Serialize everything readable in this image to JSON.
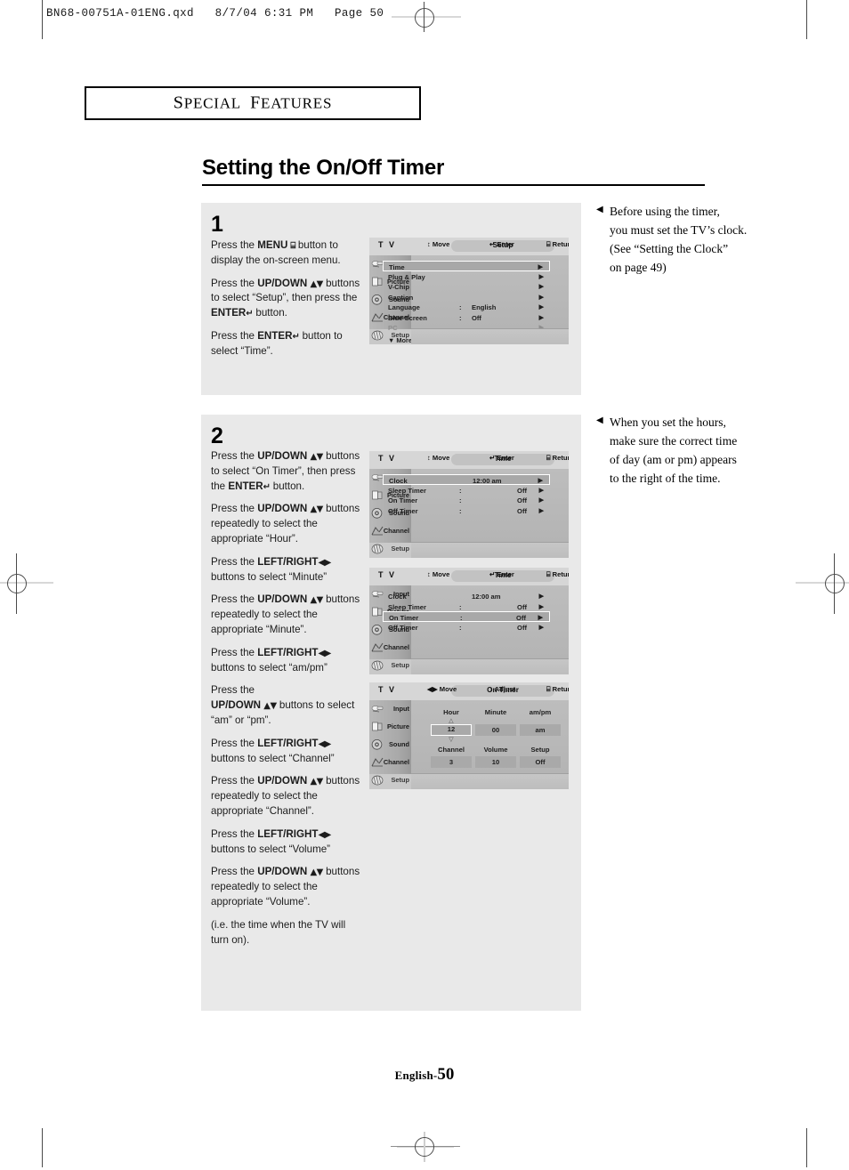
{
  "file_header": "BN68-00751A-01ENG.qxd   8/7/04 6:31 PM   Page 50",
  "section_label": "Special Features",
  "page_title": "Setting the On/Off Timer",
  "footer": {
    "language": "English-",
    "page_number": "50"
  },
  "steps": [
    {
      "number": "1",
      "paragraphs": [
        {
          "parts": [
            {
              "t": "Press the ",
              "b": false
            },
            {
              "t": "MENU",
              "b": true
            },
            {
              "t": " ⌸ ",
              "b": true,
              "glyph": true
            },
            {
              "t": "button to display the on-screen menu.",
              "b": false
            }
          ]
        },
        {
          "parts": [
            {
              "t": "Press the ",
              "b": false
            },
            {
              "t": "UP/DOWN ",
              "b": true
            },
            {
              "t": "▲▼",
              "b": true,
              "glyph": true
            },
            {
              "t": " buttons  to select “Setup”, then press the ",
              "b": false
            },
            {
              "t": "ENTER",
              "b": true
            },
            {
              "t": "↵",
              "b": true,
              "glyph": true
            },
            {
              "t": " button.",
              "b": false
            }
          ]
        },
        {
          "parts": [
            {
              "t": "Press the ",
              "b": false
            },
            {
              "t": "ENTER",
              "b": true
            },
            {
              "t": "↵",
              "b": true,
              "glyph": true
            },
            {
              "t": " button to select “Time”.",
              "b": false
            }
          ]
        }
      ]
    },
    {
      "number": "2",
      "paragraphs": [
        {
          "parts": [
            {
              "t": "Press the ",
              "b": false
            },
            {
              "t": "UP/DOWN ",
              "b": true
            },
            {
              "t": "▲▼",
              "b": true,
              "glyph": true
            },
            {
              "t": " buttons to select “On Timer”, then press the ",
              "b": false
            },
            {
              "t": "ENTER",
              "b": true
            },
            {
              "t": "↵",
              "b": true,
              "glyph": true
            },
            {
              "t": " button.",
              "b": false
            }
          ]
        },
        {
          "parts": [
            {
              "t": "Press the ",
              "b": false
            },
            {
              "t": "UP/DOWN ",
              "b": true
            },
            {
              "t": "▲▼",
              "b": true,
              "glyph": true
            },
            {
              "t": " buttons repeatedly to select the appropriate “Hour”.",
              "b": false
            }
          ]
        },
        {
          "parts": [
            {
              "t": "Press the ",
              "b": false
            },
            {
              "t": "LEFT/RIGHT",
              "b": true
            },
            {
              "t": "◀▶",
              "b": true,
              "glyph": true
            },
            {
              "t": " buttons to select “Minute”",
              "b": false
            }
          ]
        },
        {
          "parts": [
            {
              "t": "Press the ",
              "b": false
            },
            {
              "t": "UP/DOWN ",
              "b": true
            },
            {
              "t": "▲▼",
              "b": true,
              "glyph": true
            },
            {
              "t": " buttons repeatedly to select the appropriate “Minute”.",
              "b": false
            }
          ]
        },
        {
          "parts": [
            {
              "t": "Press the ",
              "b": false
            },
            {
              "t": "LEFT/RIGHT",
              "b": true
            },
            {
              "t": "◀▶",
              "b": true,
              "glyph": true
            },
            {
              "t": " buttons to select “am/pm”",
              "b": false
            }
          ]
        },
        {
          "parts": [
            {
              "t": "Press the ",
              "b": false
            },
            {
              "t": "\n",
              "b": false
            },
            {
              "t": "UP/DOWN ",
              "b": true
            },
            {
              "t": "▲▼",
              "b": true,
              "glyph": true
            },
            {
              "t": "  buttons to select “am” or “pm”.",
              "b": false
            }
          ]
        },
        {
          "parts": [
            {
              "t": "Press the ",
              "b": false
            },
            {
              "t": "LEFT/RIGHT",
              "b": true
            },
            {
              "t": "◀▶",
              "b": true,
              "glyph": true
            },
            {
              "t": " buttons to select “Channel”",
              "b": false
            }
          ]
        },
        {
          "parts": [
            {
              "t": "Press the ",
              "b": false
            },
            {
              "t": "UP/DOWN ",
              "b": true
            },
            {
              "t": "▲▼",
              "b": true,
              "glyph": true
            },
            {
              "t": " buttons repeatedly to select the appropriate “Channel”.",
              "b": false
            }
          ]
        },
        {
          "parts": [
            {
              "t": "Press the ",
              "b": false
            },
            {
              "t": "LEFT/RIGHT",
              "b": true
            },
            {
              "t": "◀▶",
              "b": true,
              "glyph": true
            },
            {
              "t": " buttons to select “Volume”",
              "b": false
            }
          ]
        },
        {
          "parts": [
            {
              "t": "Press the ",
              "b": false
            },
            {
              "t": "UP/DOWN ",
              "b": true
            },
            {
              "t": "▲▼",
              "b": true,
              "glyph": true
            },
            {
              "t": " buttons repeatedly to select the appropriate “Volume”.",
              "b": false
            }
          ]
        },
        {
          "parts": [
            {
              "t": "(i.e. the time when the TV will turn on).",
              "b": false
            }
          ]
        }
      ]
    }
  ],
  "osd_common": {
    "tv_label": "T V",
    "sidebar": [
      "Input",
      "Picture",
      "Sound",
      "Channel",
      "Setup"
    ],
    "hints_move": "Move",
    "hints_enter": "Enter",
    "hints_adjust": "Adjust",
    "hints_return": "Return"
  },
  "osd_screens": [
    {
      "id": "setup",
      "title": "Setup",
      "active_sidebar": "Setup",
      "rows": [
        {
          "name": "Time",
          "colon": "",
          "value": "",
          "arrow": "▶",
          "highlight": true,
          "dim": false
        },
        {
          "name": "Plug & Play",
          "colon": "",
          "value": "",
          "arrow": "▶",
          "highlight": false,
          "dim": false
        },
        {
          "name": "V-Chip",
          "colon": "",
          "value": "",
          "arrow": "▶",
          "highlight": false,
          "dim": false
        },
        {
          "name": "Caption",
          "colon": "",
          "value": "",
          "arrow": "▶",
          "highlight": false,
          "dim": false
        },
        {
          "name": "Language",
          "colon": ":",
          "value": "English",
          "arrow": "▶",
          "highlight": false,
          "dim": false
        },
        {
          "name": "Blue Screen",
          "colon": ":",
          "value": "Off",
          "arrow": "▶",
          "highlight": false,
          "dim": false
        },
        {
          "name": "PC",
          "colon": "",
          "value": "",
          "arrow": "▶",
          "highlight": false,
          "dim": true
        }
      ],
      "more": "▼ More",
      "hints": [
        "↕ Move",
        "↵ Enter",
        "⌸ Return"
      ]
    },
    {
      "id": "time-clock",
      "title": "Time",
      "active_sidebar": "Setup",
      "rows": [
        {
          "name": "Clock",
          "colon": "",
          "value": "12:00 am",
          "value_pos": "mid",
          "arrow": "▶",
          "highlight": true,
          "dim": false
        },
        {
          "name": "Sleep Timer",
          "colon": ":",
          "value": "Off",
          "value_pos": "right",
          "arrow": "▶",
          "highlight": false,
          "dim": false
        },
        {
          "name": "On Timer",
          "colon": ":",
          "value": "Off",
          "value_pos": "right",
          "arrow": "▶",
          "highlight": false,
          "dim": false
        },
        {
          "name": "Off Timer",
          "colon": ":",
          "value": "Off",
          "value_pos": "right",
          "arrow": "▶",
          "highlight": false,
          "dim": false
        }
      ],
      "hints": [
        "↕ Move",
        "↵ Enter",
        "⌸ Return"
      ]
    },
    {
      "id": "time-ontimer",
      "title": "Time",
      "active_sidebar": "Setup",
      "rows": [
        {
          "name": "Clock",
          "colon": "",
          "value": "12:00 am",
          "value_pos": "mid",
          "arrow": "▶",
          "highlight": false,
          "dim": false
        },
        {
          "name": "Sleep Timer",
          "colon": ":",
          "value": "Off",
          "value_pos": "right",
          "arrow": "▶",
          "highlight": false,
          "dim": false
        },
        {
          "name": "On Timer",
          "colon": ":",
          "value": "Off",
          "value_pos": "right",
          "arrow": "▶",
          "highlight": true,
          "dim": false
        },
        {
          "name": "Off Timer",
          "colon": ":",
          "value": "Off",
          "value_pos": "right",
          "arrow": "▶",
          "highlight": false,
          "dim": false
        }
      ],
      "hints": [
        "↕ Move",
        "↵ Enter",
        "⌸ Return"
      ]
    },
    {
      "id": "on-timer",
      "title": "On Timer",
      "active_sidebar": "Setup",
      "grid": {
        "row1_headers": [
          "Hour",
          "Minute",
          "am/pm"
        ],
        "row1_values": [
          "12",
          "00",
          "am"
        ],
        "row1_selected_index": 0,
        "row2_headers": [
          "Channel",
          "Volume",
          "Setup"
        ],
        "row2_values": [
          "3",
          "10",
          "Off"
        ]
      },
      "hints": [
        "◀▶ Move",
        "↕ Adjust",
        "⌸ Return"
      ]
    }
  ],
  "notes": [
    {
      "bullet": "◀",
      "lines": [
        "Before using the timer,",
        "you must set the TV’s clock.",
        "(See “Setting the Clock”",
        "on page 49)"
      ]
    },
    {
      "bullet": "◀",
      "lines": [
        "When you set the hours,",
        "make sure the correct time",
        "of day (am or pm) appears",
        "to the right of the time."
      ]
    }
  ]
}
